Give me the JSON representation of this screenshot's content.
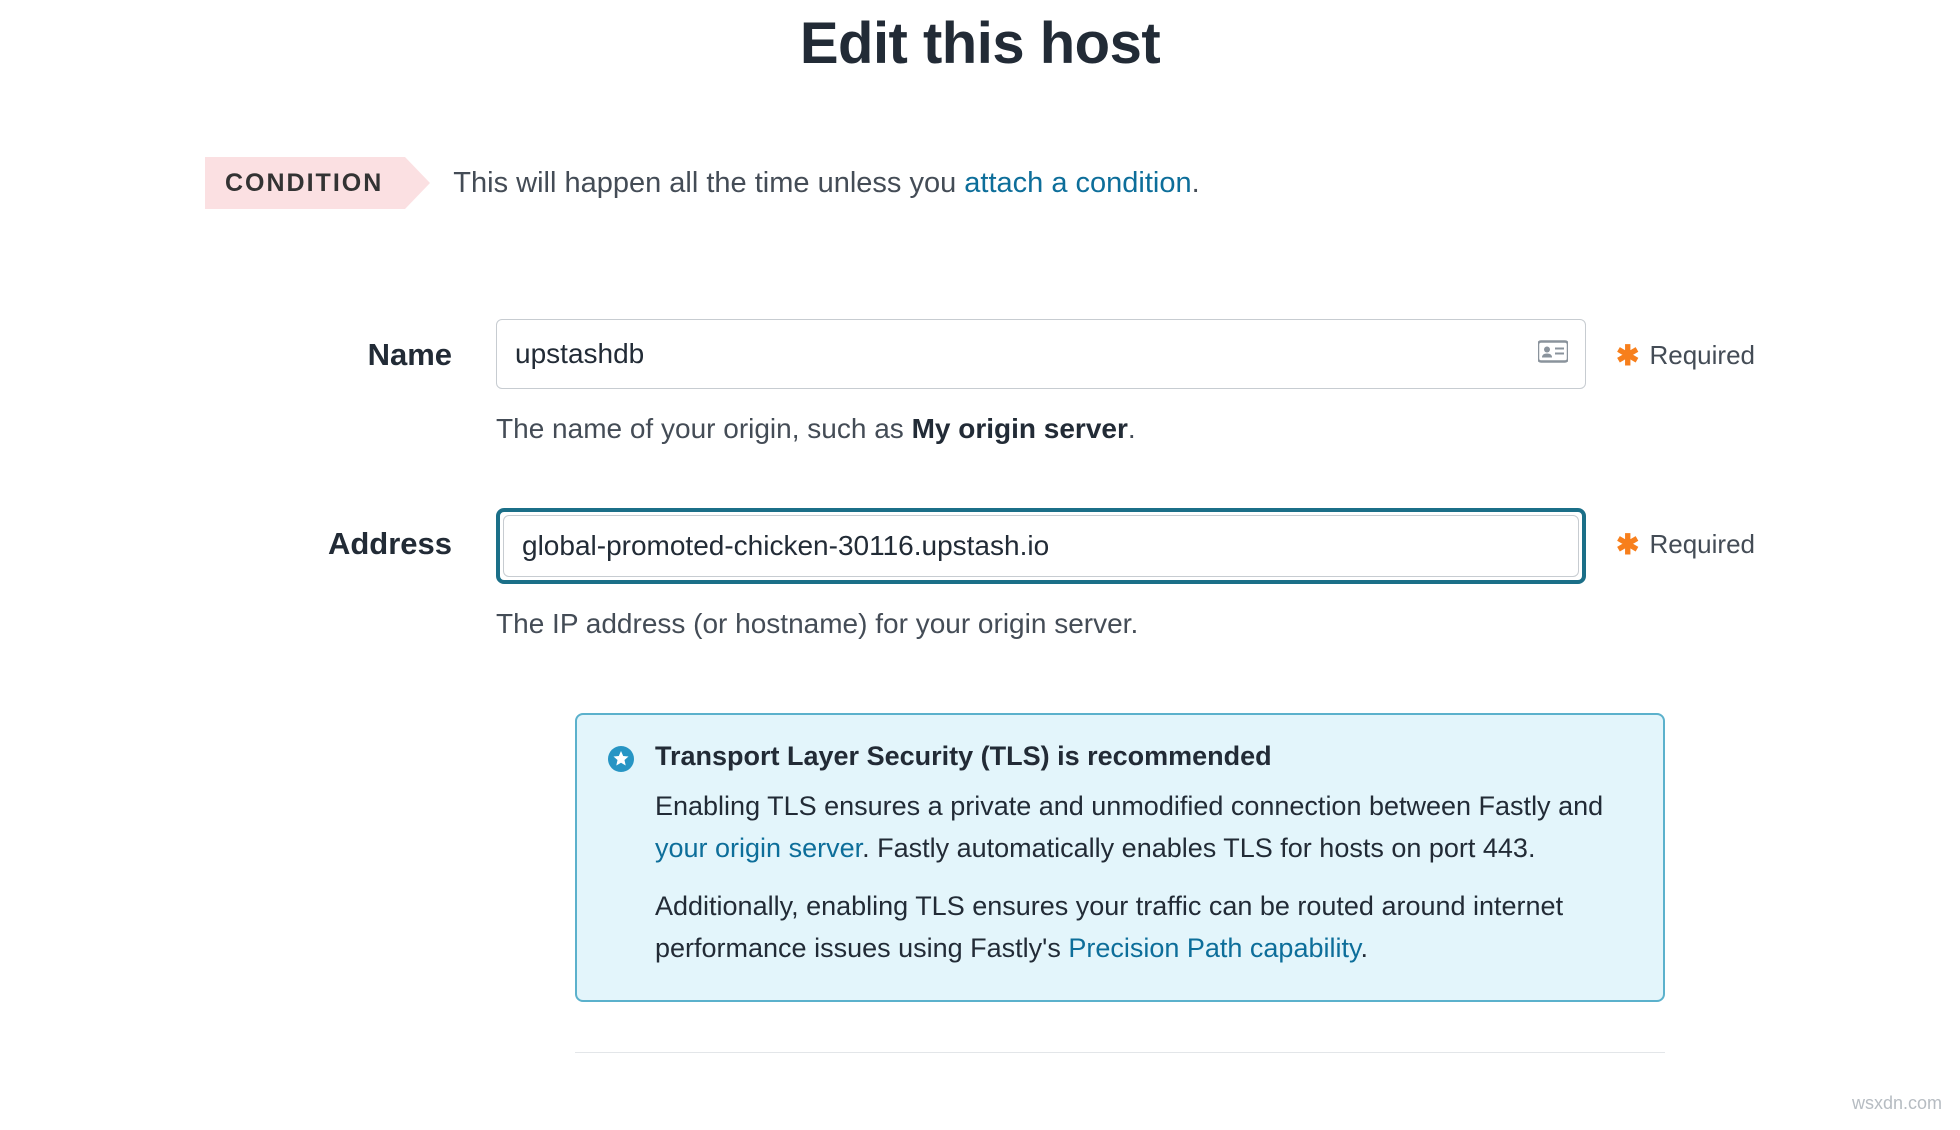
{
  "page": {
    "title": "Edit this host"
  },
  "condition": {
    "badge": "CONDITION",
    "text_prefix": "This will happen all the time unless you ",
    "link": "attach a condition",
    "text_suffix": "."
  },
  "fields": {
    "name": {
      "label": "Name",
      "value": "upstashdb",
      "required_label": "Required",
      "helper_prefix": "The name of your origin, such as ",
      "helper_bold": "My origin server",
      "helper_suffix": "."
    },
    "address": {
      "label": "Address",
      "value": "global-promoted-chicken-30116.upstash.io",
      "required_label": "Required",
      "helper": "The IP address (or hostname) for your origin server."
    }
  },
  "tls_info": {
    "title": "Transport Layer Security (TLS) is recommended",
    "p1_a": "Enabling TLS ensures a private and unmodified connection between Fastly and ",
    "p1_link": "your origin server",
    "p1_b": ". Fastly automatically enables TLS for hosts on port 443.",
    "p2_a": "Additionally, enabling TLS ensures your traffic can be routed around internet performance issues using Fastly's ",
    "p2_link": "Precision Path capability",
    "p2_b": "."
  },
  "watermark": "wsxdn.com"
}
